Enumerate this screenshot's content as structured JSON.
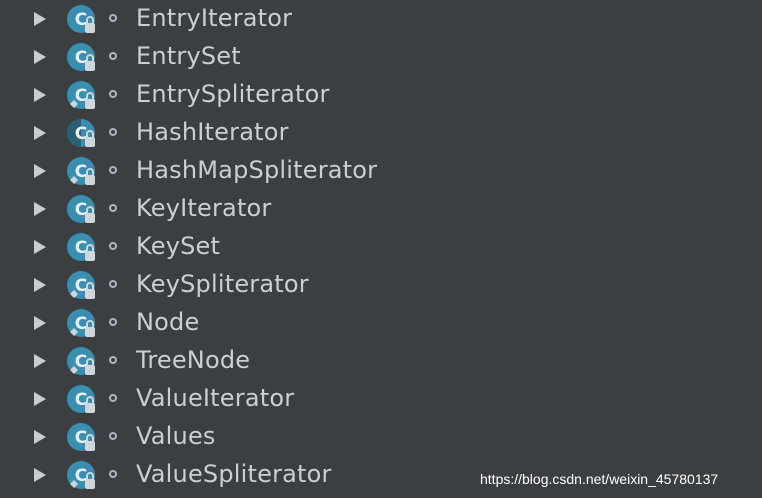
{
  "tree": {
    "items": [
      {
        "label": "EntryIterator",
        "icon": "abstract-class-icon"
      },
      {
        "label": "EntrySet",
        "icon": "final-class-icon"
      },
      {
        "label": "EntrySpliterator",
        "icon": "static-class-icon"
      },
      {
        "label": "HashIterator",
        "icon": "abstract-class-icon"
      },
      {
        "label": "HashMapSpliterator",
        "icon": "static-class-icon"
      },
      {
        "label": "KeyIterator",
        "icon": "final-class-icon"
      },
      {
        "label": "KeySet",
        "icon": "final-class-icon"
      },
      {
        "label": "KeySpliterator",
        "icon": "static-class-icon"
      },
      {
        "label": "Node",
        "icon": "static-class-icon"
      },
      {
        "label": "TreeNode",
        "icon": "static-class-icon"
      },
      {
        "label": "ValueIterator",
        "icon": "final-class-icon"
      },
      {
        "label": "Values",
        "icon": "final-class-icon"
      },
      {
        "label": "ValueSpliterator",
        "icon": "static-class-icon"
      }
    ]
  },
  "watermark": "https://blog.csdn.net/weixin_45780137",
  "colors": {
    "background": "#3c3f41",
    "text": "#c8d0d7",
    "icon_teal": "#3a8fb0",
    "icon_light": "#cfd6dc"
  }
}
